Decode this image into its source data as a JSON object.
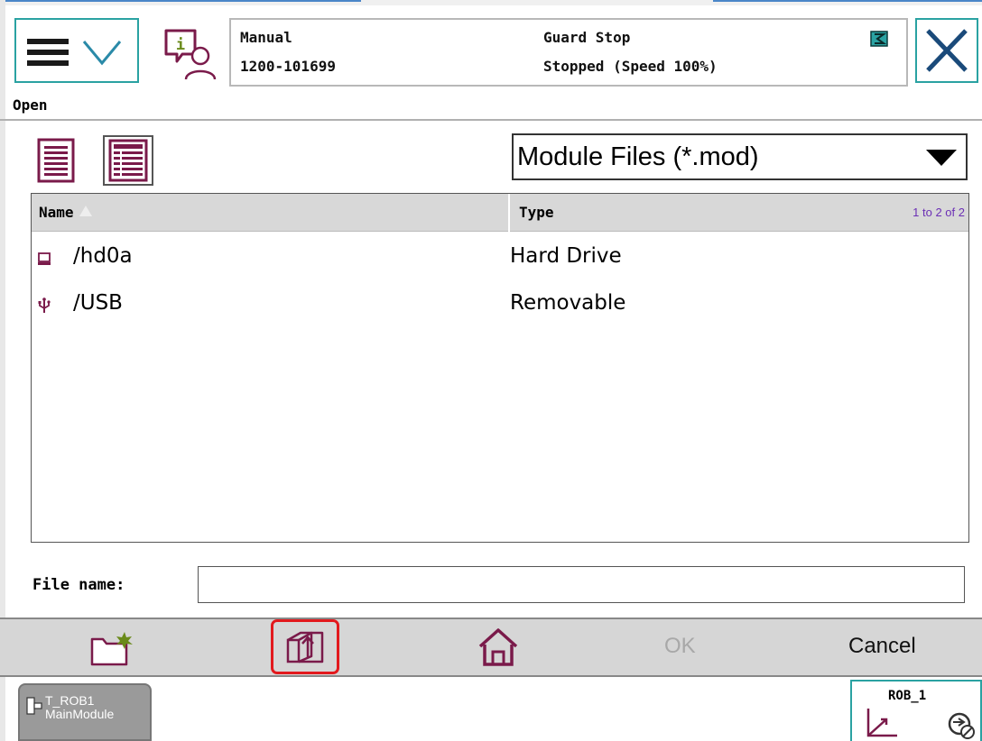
{
  "header": {
    "mode": "Manual",
    "system_id": "1200-101699",
    "safety_state": "Guard Stop",
    "run_state": "Stopped (Speed 100%)"
  },
  "dialog": {
    "title": "Open"
  },
  "filter": {
    "selected": "Module Files (*.mod)"
  },
  "file_list": {
    "columns": [
      "Name",
      "Type"
    ],
    "count_text": "1 to 2 of 2",
    "rows": [
      {
        "name": "/hd0a",
        "type": "Hard Drive",
        "icon": "hard-drive-icon"
      },
      {
        "name": "/USB",
        "type": "Removable",
        "icon": "usb-icon"
      }
    ]
  },
  "file_name": {
    "label": "File name:",
    "value": ""
  },
  "actions": {
    "ok": "OK",
    "cancel": "Cancel"
  },
  "taskbar": {
    "task_line1": "T_ROB1",
    "task_line2": "MainModule",
    "robot": "ROB_1"
  },
  "colors": {
    "accent": "#2aa2a2",
    "icon": "#7a1a4a",
    "highlight": "#e2191d",
    "count": "#6b2fb5"
  }
}
